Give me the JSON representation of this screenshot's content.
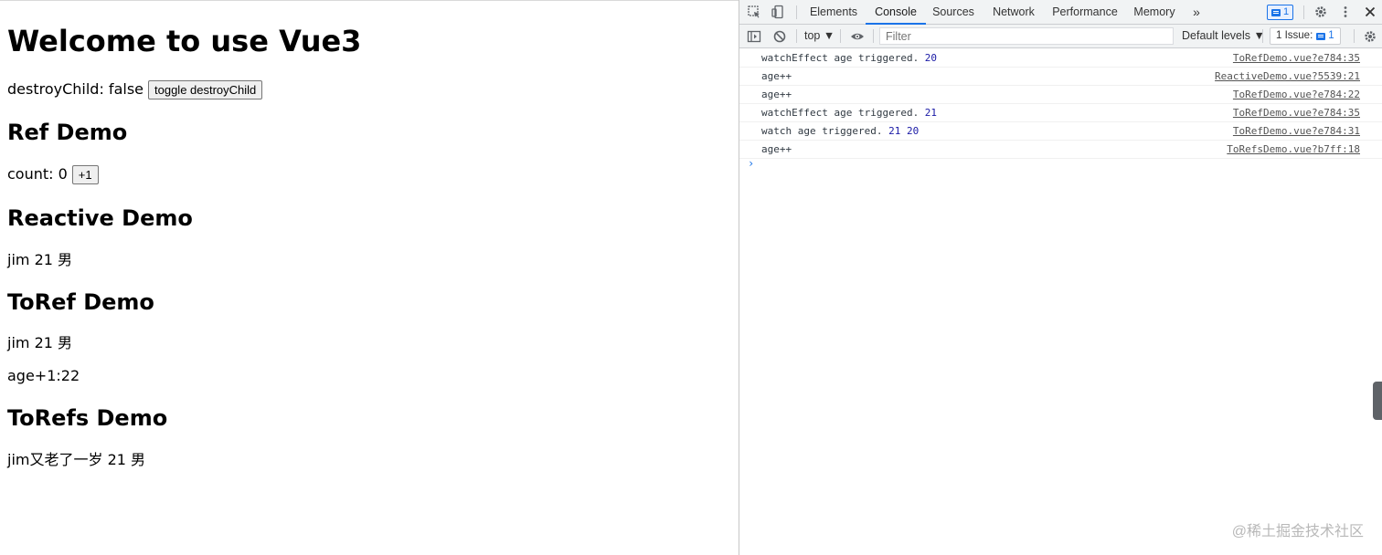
{
  "app": {
    "title": "Welcome to use Vue3",
    "destroy_child_label": "destroyChild: false",
    "toggle_button_label": "toggle destroyChild"
  },
  "ref_demo": {
    "heading": "Ref Demo",
    "count_label": "count: 0",
    "increment_button_label": "+1"
  },
  "reactive_demo": {
    "heading": "Reactive Demo",
    "text": "jim 21 男"
  },
  "toref_demo": {
    "heading": "ToRef Demo",
    "text": "jim 21 男",
    "age_plus_one": "age+1:22"
  },
  "torefs_demo": {
    "heading": "ToRefs Demo",
    "text": "jim又老了一岁 21 男"
  },
  "devtools": {
    "tabs": [
      "Elements",
      "Console",
      "Sources",
      "Network",
      "Performance",
      "Memory"
    ],
    "active_tab": "Console",
    "more_tabs_icon": "»",
    "message_badge_count": "1",
    "context": "top ▼",
    "filter_placeholder": "Filter",
    "levels": "Default levels ▼",
    "issues_label": "1 Issue:",
    "issues_count": "1",
    "console_rows": [
      {
        "text": "watchEffect age triggered.",
        "nums": " 20",
        "source": "ToRefDemo.vue?e784:35"
      },
      {
        "text": "age++",
        "nums": "",
        "source": "ReactiveDemo.vue?5539:21"
      },
      {
        "text": "age++",
        "nums": "",
        "source": "ToRefDemo.vue?e784:22"
      },
      {
        "text": "watchEffect age triggered.",
        "nums": " 21",
        "source": "ToRefDemo.vue?e784:35"
      },
      {
        "text": "watch age triggered.",
        "nums": " 21 20",
        "source": "ToRefDemo.vue?e784:31"
      },
      {
        "text": "age++",
        "nums": "",
        "source": "ToRefsDemo.vue?b7ff:18"
      }
    ],
    "prompt_symbol": "›"
  },
  "watermark": "@稀土掘金技术社区",
  "colors": {
    "accent": "#1a73e8",
    "number": "#1a1aa6"
  }
}
